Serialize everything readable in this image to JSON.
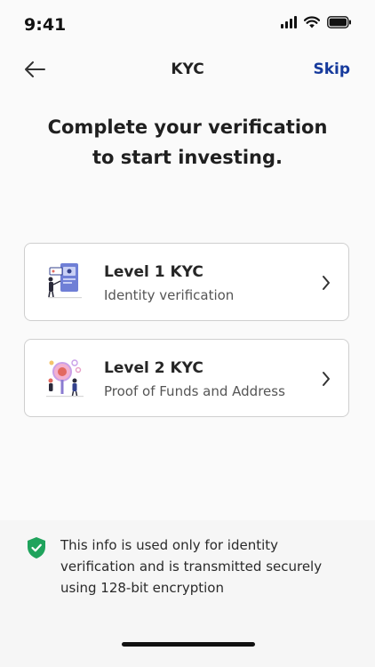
{
  "status_bar": {
    "time": "9:41"
  },
  "header": {
    "title": "KYC",
    "skip_label": "Skip"
  },
  "headline": {
    "line1": "Complete your verification",
    "line2": "to start investing."
  },
  "levels": [
    {
      "title": "Level 1 KYC",
      "subtitle": "Identity verification",
      "icon": "id-card-illustration"
    },
    {
      "title": "Level 2 KYC",
      "subtitle": "Proof of Funds and Address",
      "icon": "magnifier-illustration"
    }
  ],
  "footer": {
    "info": "This info is used only for identity verification and is transmitted securely using 128-bit encryption",
    "icon": "shield-check-icon"
  },
  "colors": {
    "accent": "#163a9c",
    "shield": "#1fa35c",
    "card_border": "#cfcfcf"
  }
}
